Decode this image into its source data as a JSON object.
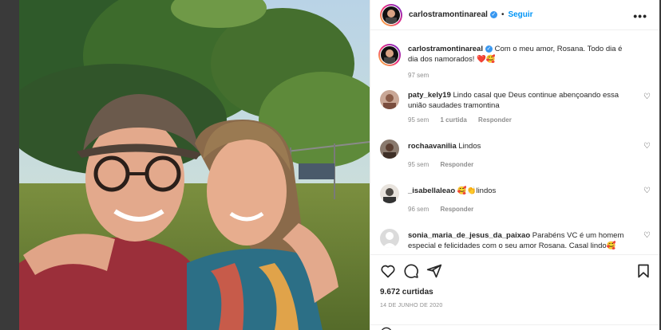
{
  "post": {
    "username": "carlostramontinareal",
    "follow_label": "Seguir",
    "caption": "Com o meu amor, Rosana. Todo dia é dia dos namorados!",
    "caption_emoji": "❤️🥰",
    "caption_time": "97 sem"
  },
  "comments": [
    {
      "username": "paty_kely19",
      "text": "Lindo casal que Deus continue abençoando essa união saudades tramontina",
      "time": "95 sem",
      "likes": "1 curtida",
      "reply": "Responder",
      "avatar_color": "#a07b6e"
    },
    {
      "username": "rochaavanilia",
      "text": "Lindos",
      "time": "95 sem",
      "reply": "Responder",
      "avatar_color": "#6e5b4f"
    },
    {
      "username": "_isabellaleao",
      "text": "🥰👏lindos",
      "time": "96 sem",
      "reply": "Responder",
      "avatar_color": "#4e4a45"
    },
    {
      "username": "sonia_maria_de_jesus_da_paixao",
      "text": "Parabéns VC é um homem especial e felicidades com o seu amor Rosana. Casal lindo🥰",
      "avatar_color": "#dbdbdb"
    }
  ],
  "footer": {
    "likes": "9.672 curtidas",
    "date": "14 DE JUNHO DE 2020"
  },
  "colors": {
    "link": "#0095f6",
    "verified": "#3897f0",
    "muted": "#8e8e8e",
    "text": "#262626"
  },
  "icons": [
    "heart-icon",
    "comment-icon",
    "share-icon",
    "bookmark-icon",
    "more-icon",
    "verified-icon"
  ]
}
